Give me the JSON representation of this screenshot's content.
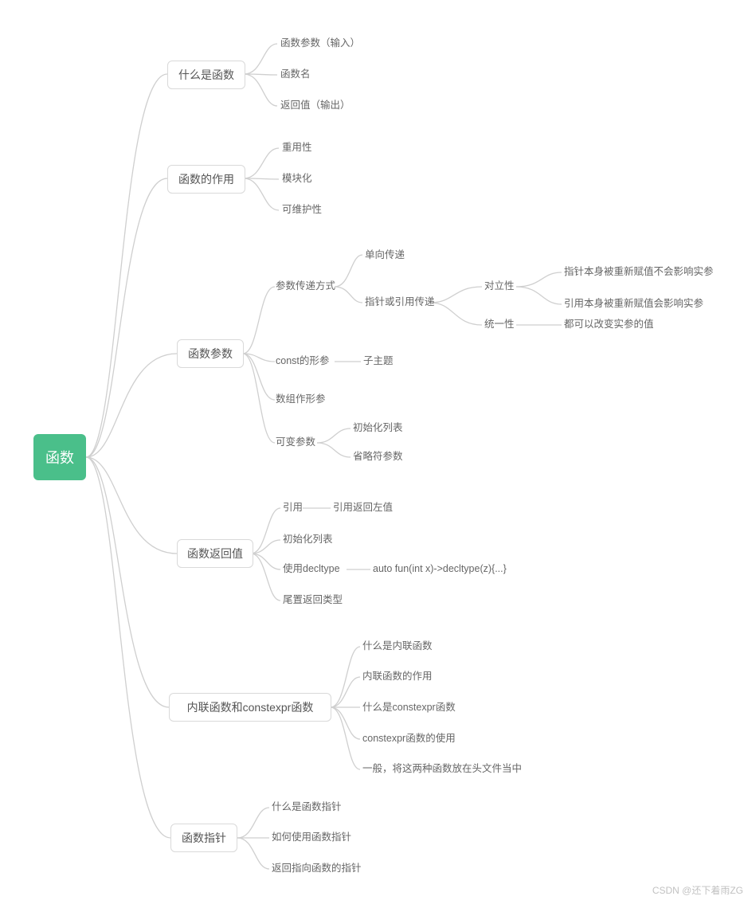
{
  "root": {
    "label": "函数"
  },
  "branches": {
    "b1": {
      "label": "什么是函数",
      "children": [
        "函数参数（输入）",
        "函数名",
        "返回值（输出）"
      ]
    },
    "b2": {
      "label": "函数的作用",
      "children": [
        "重用性",
        "模块化",
        "可维护性"
      ]
    },
    "b3": {
      "label": "函数参数",
      "c1": {
        "label": "参数传递方式",
        "g1": "单向传递",
        "g2": {
          "label": "指针或引用传递",
          "gc1": {
            "label": "对立性",
            "leaves": [
              "指针本身被重新赋值不会影响实参",
              "引用本身被重新赋值会影响实参"
            ]
          },
          "gc2": {
            "label": "统一性",
            "leaf": "都可以改变实参的值"
          }
        }
      },
      "c2": {
        "label": "const的形参",
        "leaf": "子主题"
      },
      "c3": "数组作形参",
      "c4": {
        "label": "可变参数",
        "leaves": [
          "初始化列表",
          "省略符参数"
        ]
      }
    },
    "b4": {
      "label": "函数返回值",
      "c1": {
        "label": "引用",
        "leaf": "引用返回左值"
      },
      "c2": "初始化列表",
      "c3": {
        "label": "使用decltype",
        "leaf": "auto fun(int x)->decltype(z){...}"
      },
      "c4": "尾置返回类型"
    },
    "b5": {
      "label": "内联函数和constexpr函数",
      "children": [
        "什么是内联函数",
        "内联函数的作用",
        "什么是constexpr函数",
        "constexpr函数的使用",
        "一般，将这两种函数放在头文件当中"
      ]
    },
    "b6": {
      "label": "函数指针",
      "children": [
        "什么是函数指针",
        "如何使用函数指针",
        "返回指向函数的指针"
      ]
    }
  },
  "watermark": "CSDN @还下着雨ZG"
}
